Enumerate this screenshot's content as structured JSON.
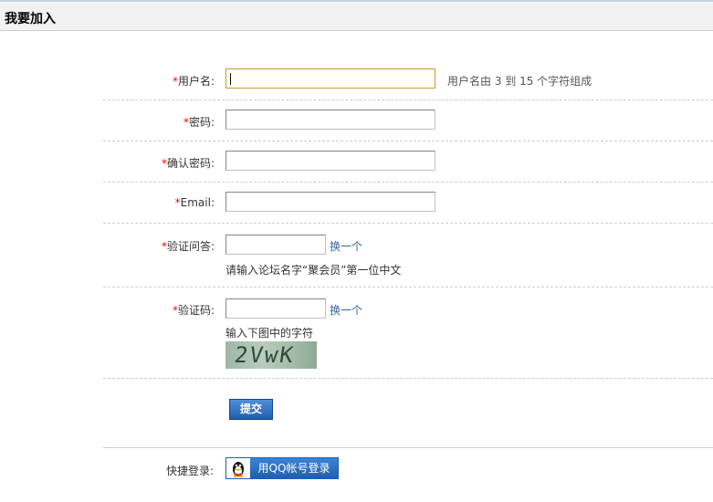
{
  "header": {
    "title": "我要加入"
  },
  "form": {
    "required_mark": "*",
    "username": {
      "label": "用户名:",
      "hint": "用户名由 3 到 15 个字符组成"
    },
    "password": {
      "label": "密码:"
    },
    "confirm_password": {
      "label": "确认密码:"
    },
    "email": {
      "label": "Email:"
    },
    "security_question": {
      "label": "验证问答:",
      "refresh_link": "换一个",
      "question": "请输入论坛名字“聚会员”第一位中文"
    },
    "captcha": {
      "label": "验证码:",
      "refresh_link": "换一个",
      "instruction": "输入下图中的字符",
      "image_text": "2VwK"
    },
    "submit_label": "提交"
  },
  "quick_login": {
    "label": "快捷登录:",
    "qq_button_label": "用QQ帐号登录"
  }
}
